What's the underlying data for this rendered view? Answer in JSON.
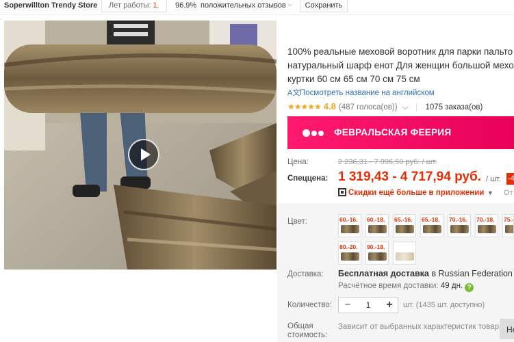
{
  "store": {
    "name": "Soperwillton Trendy Store",
    "years_label": "Лет работы: ",
    "years_value": "1",
    "years_suffix": ".",
    "positive_pct": "96.9%",
    "positive_label": "положительных отзывов",
    "save_label": "Сохранить"
  },
  "photo": {
    "has_video": true
  },
  "product": {
    "title_lines": [
      "100% реальные меховой воротник для парки пальто",
      "натуральный шарф енот Для женщин большой мехо",
      "куртки 60 см 65 см 70 см 75 см"
    ],
    "translate_label": "Посмотреть название на английском",
    "stars": "★★★★★",
    "rating": "4.8",
    "votes": "(487 голоса(ов))",
    "orders": "1075 заказа(ов)"
  },
  "promo": {
    "label": "ФЕВРАЛЬСКАЯ ФЕЕРИЯ",
    "color": "#ff1a6e"
  },
  "price": {
    "label": "Цена:",
    "old": "2 236,31 - 7 996,50 руб. / шт.",
    "special_label": "Спеццена:",
    "new": "1 319,43 - 4 717,94 руб.",
    "unit": "/ шт.",
    "discount": "-4",
    "app_label": "Скидки ещё больше в приложении",
    "app_more": "От"
  },
  "color": {
    "label": "Цвет:",
    "options": [
      {
        "text": "60.-16.",
        "light": false
      },
      {
        "text": "60.-18.",
        "light": false
      },
      {
        "text": "65.-16.",
        "light": false
      },
      {
        "text": "65.-18.",
        "light": false
      },
      {
        "text": "70.-16.",
        "light": false
      },
      {
        "text": "70.-18.",
        "light": false
      },
      {
        "text": "75.-1",
        "light": false
      },
      {
        "text": "80.-20.",
        "light": false
      },
      {
        "text": "90.-18.",
        "light": false
      },
      {
        "text": "",
        "light": true
      }
    ]
  },
  "delivery": {
    "label": "Доставка:",
    "free_prefix": "Бесплатная доставка",
    "free_mid": " в ",
    "country": "Russian Federation сл",
    "time_label": "Расчётное время доставки: ",
    "days": "49 дн.",
    "help": "?"
  },
  "quantity": {
    "label": "Количество:",
    "minus": "−",
    "value": "1",
    "plus": "+",
    "available": "шт. (1435 шт. доступно)"
  },
  "total": {
    "label_line1": "Общая",
    "label_line2": "стоимость:",
    "note": "Зависит от выбранных характеристик товара",
    "button": "Не"
  }
}
